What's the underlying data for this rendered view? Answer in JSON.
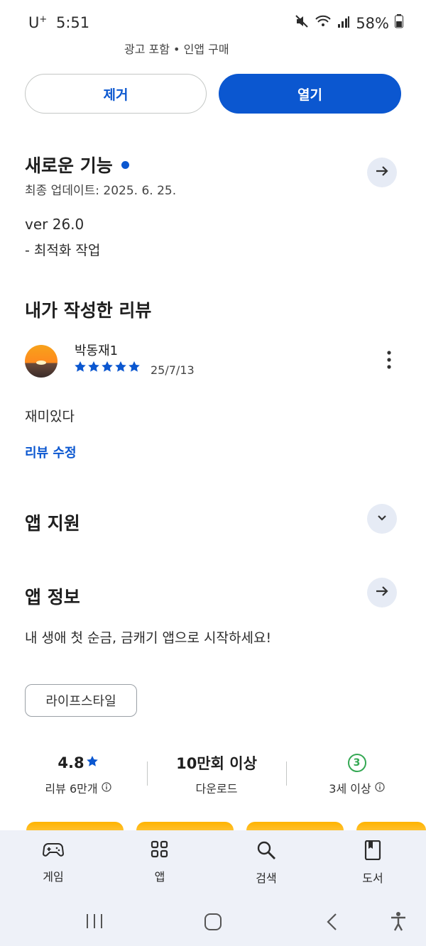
{
  "status_bar": {
    "carrier": "U",
    "carrier_sup": "+",
    "time": "5:51",
    "battery": "58%"
  },
  "ad_line": "광고 포함 • 인앱 구매",
  "actions": {
    "remove_label": "제거",
    "open_label": "열기"
  },
  "whats_new": {
    "title": "새로운 기능",
    "updated": "최종 업데이트: 2025. 6. 25.",
    "version": "ver 26.0",
    "notes": "- 최적화 작업"
  },
  "my_review": {
    "section_title": "내가 작성한 리뷰",
    "author": "박동재1",
    "stars": 5,
    "date": "25/7/13",
    "text": "재미있다",
    "edit_label": "리뷰 수정"
  },
  "app_support": {
    "title": "앱 지원"
  },
  "app_info": {
    "title": "앱 정보",
    "description": "내 생애 첫 순금, 금캐기 앱으로 시작하세요!",
    "category_chip": "라이프스타일"
  },
  "stats": {
    "rating": "4.8",
    "rating_label": "리뷰 6만개",
    "downloads": "10만회 이상",
    "downloads_label": "다운로드",
    "age_badge": "3",
    "age_label": "3세 이상"
  },
  "bottom_nav": {
    "games": "게임",
    "apps": "앱",
    "search": "검색",
    "books": "도서"
  },
  "colors": {
    "accent": "#0b57d0",
    "circle_button_bg": "#e6ebf5",
    "nav_bg": "#eef1f8",
    "age_badge": "#34a853",
    "promo_card": "#ffb300"
  }
}
